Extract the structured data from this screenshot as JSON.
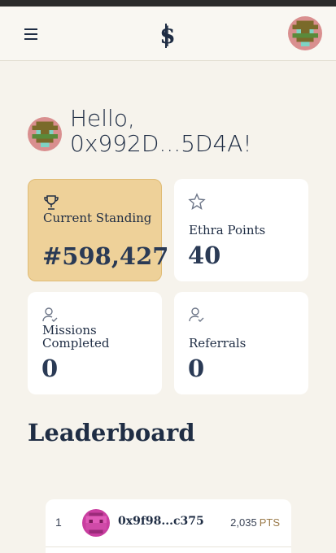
{
  "header": {
    "menu_icon": "hamburger-icon",
    "logo_icon": "dollar-logo-icon",
    "avatar_icon": "user-avatar"
  },
  "greeting": {
    "line1": "Hello,",
    "line2": "0x992D...5D4A!"
  },
  "stats": [
    {
      "label": "Current Standing",
      "value": "#598,427",
      "icon": "trophy-icon",
      "highlight": true
    },
    {
      "label": "Ethra Points",
      "value": "40",
      "icon": "star-icon",
      "highlight": false
    },
    {
      "label": "Missions Completed",
      "value": "0",
      "icon": "user-check-icon",
      "highlight": false
    },
    {
      "label": "Referrals",
      "value": "0",
      "icon": "user-check-icon",
      "highlight": false
    }
  ],
  "leaderboard": {
    "title": "Leaderboard",
    "rows": [
      {
        "rank": "1",
        "address": "0x9f98...c375",
        "points": "2,035",
        "unit": "PTS"
      }
    ]
  },
  "colors": {
    "background": "#f6f3ec",
    "card": "#ffffff",
    "highlight_card": "#eed199",
    "text": "#1f2d44",
    "pts_unit": "#9a7a4a"
  }
}
